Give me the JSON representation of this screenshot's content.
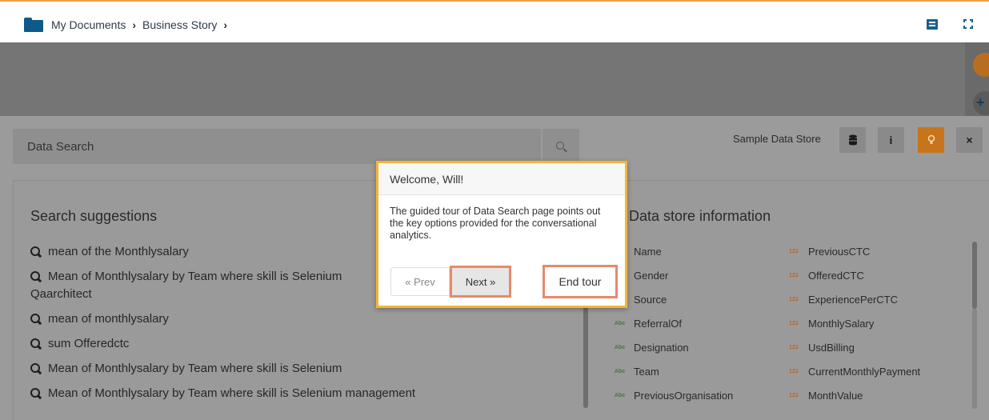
{
  "breadcrumb": {
    "items": [
      "My Documents",
      "Business Story"
    ]
  },
  "search": {
    "placeholder": "Data Search"
  },
  "data_store": {
    "label": "Sample Data Store"
  },
  "toolbar": {
    "info_label": "i",
    "close_label": "×"
  },
  "suggestions": {
    "title": "Search suggestions",
    "items": [
      "mean of the Monthlysalary",
      "Mean of Monthlysalary by Team where skill is Selenium Qaarchitect",
      "mean of monthlysalary",
      "sum Offeredctc",
      "Mean of Monthlysalary by Team where skill is Selenium",
      "Mean of Monthlysalary by Team where skill is Selenium management"
    ]
  },
  "store_info": {
    "title": "Data store information",
    "left_fields": [
      {
        "type": "Abc",
        "name": "Name"
      },
      {
        "type": "Abc",
        "name": "Gender"
      },
      {
        "type": "Abc",
        "name": "Source"
      },
      {
        "type": "Abc",
        "name": "ReferralOf"
      },
      {
        "type": "Abc",
        "name": "Designation"
      },
      {
        "type": "Abc",
        "name": "Team"
      },
      {
        "type": "Abc",
        "name": "PreviousOrganisation"
      }
    ],
    "right_fields": [
      {
        "type": "123",
        "name": "PreviousCTC"
      },
      {
        "type": "123",
        "name": "OfferedCTC"
      },
      {
        "type": "123",
        "name": "ExperiencePerCTC"
      },
      {
        "type": "123",
        "name": "MonthlySalary"
      },
      {
        "type": "123",
        "name": "UsdBilling"
      },
      {
        "type": "123",
        "name": "CurrentMonthlyPayment"
      },
      {
        "type": "123",
        "name": "MonthValue"
      }
    ]
  },
  "tour": {
    "title": "Welcome, Will!",
    "body": "The guided tour of Data Search page points out the key options provided for the conversational analytics.",
    "prev_label": "« Prev",
    "next_label": "Next »",
    "end_label": "End tour"
  },
  "colors": {
    "accent": "#f4b533",
    "brand": "#0d5a8a",
    "active": "#c8741c"
  }
}
